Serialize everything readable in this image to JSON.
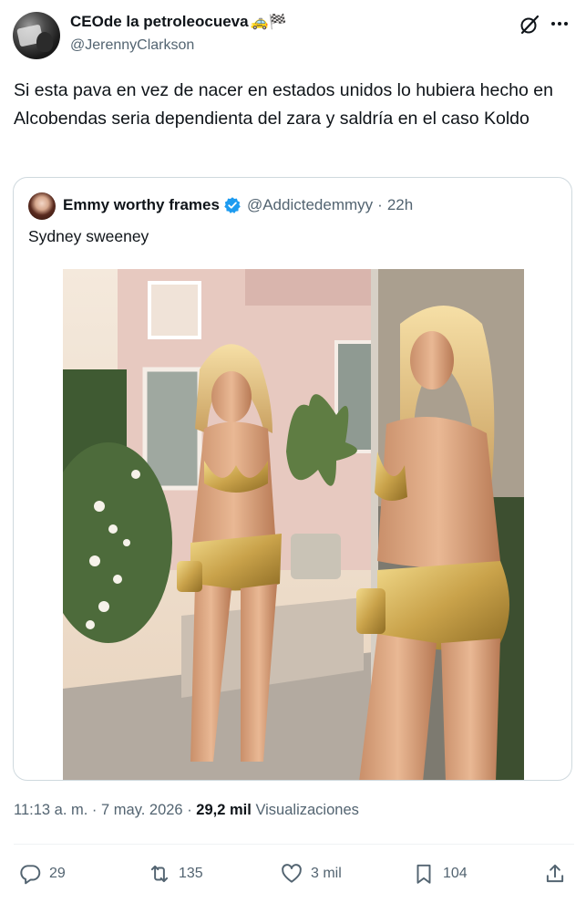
{
  "author": {
    "name": "CEOde la petroleocueva",
    "name_emoji": "🚕🏁",
    "handle": "@JerennyClarkson"
  },
  "tweet": {
    "text": "Si esta pava en vez de nacer en estados unidos lo hubiera hecho en Alcobendas seria dependienta del zara y saldría en el caso Koldo"
  },
  "quote": {
    "name": "Emmy worthy frames",
    "handle": "@Addictedemmyy",
    "separator": "·",
    "time": "22h",
    "text": "Sydney sweeney",
    "image_desc_icon": "photo"
  },
  "stats": {
    "time": "11:13 a. m.",
    "dot1": "·",
    "date": "7 may. 2026",
    "dot2": "·",
    "views_count": "29,2 mil",
    "views_label": "Visualizaciones"
  },
  "actions": {
    "replies": "29",
    "reposts": "135",
    "likes": "3 mil",
    "bookmarks": "104"
  },
  "colors": {
    "text": "#0f1419",
    "secondary": "#536471",
    "verified": "#1d9bf0",
    "border": "#cfd9de"
  }
}
